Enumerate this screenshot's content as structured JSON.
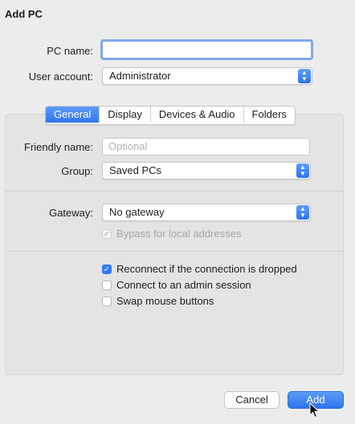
{
  "dialog": {
    "title": "Add PC"
  },
  "pc_name": {
    "label": "PC name:",
    "value": ""
  },
  "user_account": {
    "label": "User account:",
    "value": "Administrator"
  },
  "tabs": [
    {
      "label": "General",
      "active": true
    },
    {
      "label": "Display",
      "active": false
    },
    {
      "label": "Devices & Audio",
      "active": false
    },
    {
      "label": "Folders",
      "active": false
    }
  ],
  "general": {
    "friendly_name": {
      "label": "Friendly name:",
      "placeholder": "Optional",
      "value": ""
    },
    "group": {
      "label": "Group:",
      "value": "Saved PCs"
    },
    "gateway": {
      "label": "Gateway:",
      "value": "No gateway"
    },
    "bypass": {
      "label": "Bypass for local addresses",
      "checked": true,
      "enabled": false
    },
    "options": [
      {
        "label": "Reconnect if the connection is dropped",
        "checked": true
      },
      {
        "label": "Connect to an admin session",
        "checked": false
      },
      {
        "label": "Swap mouse buttons",
        "checked": false
      }
    ]
  },
  "buttons": {
    "cancel": "Cancel",
    "add": "Add"
  },
  "colors": {
    "accent": "#2f7cf6",
    "focus_ring": "#7fa9e8",
    "panel_bg": "#e4e4e4"
  }
}
